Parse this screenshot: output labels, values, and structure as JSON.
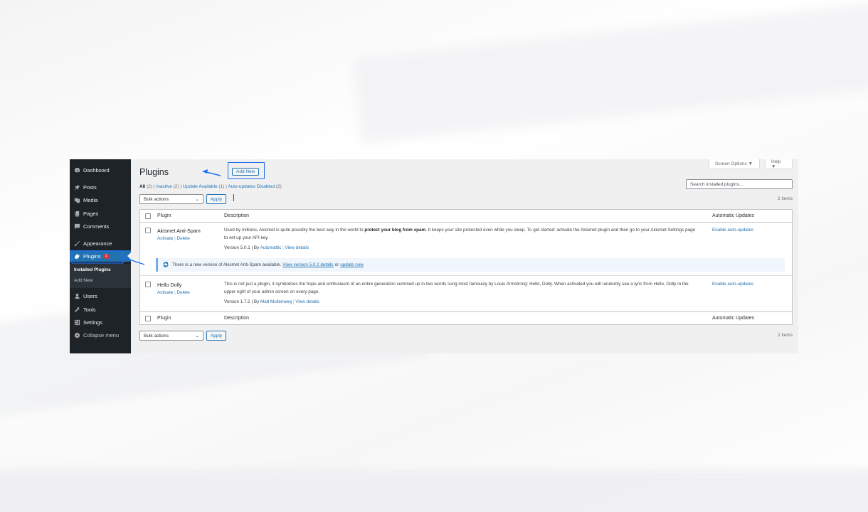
{
  "sidebar": {
    "items": [
      {
        "label": "Dashboard",
        "icon": "dashboard-icon"
      },
      {
        "label": "Posts",
        "icon": "pin-icon"
      },
      {
        "label": "Media",
        "icon": "media-icon"
      },
      {
        "label": "Pages",
        "icon": "pages-icon"
      },
      {
        "label": "Comments",
        "icon": "comment-icon"
      },
      {
        "label": "Appearance",
        "icon": "brush-icon"
      },
      {
        "label": "Plugins",
        "icon": "plug-icon",
        "badge": "1",
        "active": true
      },
      {
        "label": "Users",
        "icon": "user-icon"
      },
      {
        "label": "Tools",
        "icon": "wrench-icon"
      },
      {
        "label": "Settings",
        "icon": "settings-icon"
      },
      {
        "label": "Collapse menu",
        "icon": "collapse-icon"
      }
    ],
    "submenu": [
      {
        "label": "Installed Plugins",
        "current": true
      },
      {
        "label": "Add New",
        "current": false
      }
    ]
  },
  "header": {
    "title": "Plugins",
    "add_new_label": "Add New",
    "screen_options_label": "Screen Options ▼",
    "help_label": "Help ▼"
  },
  "views": {
    "all": "All",
    "all_count": "(2)",
    "inactive": "Inactive",
    "inactive_count": "(2)",
    "update": "Update Available",
    "update_count": "(1)",
    "autoupdates": "Auto-updates Disabled",
    "autoupdates_count": "(2)"
  },
  "search": {
    "placeholder": "Search installed plugins..."
  },
  "bulk": {
    "label": "Bulk actions",
    "apply": "Apply",
    "items": "2 items"
  },
  "table": {
    "columns": {
      "plugin": "Plugin",
      "description": "Description",
      "auto": "Automatic Updates"
    },
    "rows": [
      {
        "name": "Akismet Anti-Spam",
        "activate": "Activate",
        "delete": "Delete",
        "desc_pre": "Used by millions, Akismet is quite possibly the best way in the world to ",
        "desc_bold": "protect your blog from spam",
        "desc_post": ". It keeps your site protected even while you sleep. To get started: activate the Akismet plugin and then go to your Akismet Settings page to set up your API key.",
        "version": "Version 5.0.1 | By ",
        "author": "Automattic",
        "view_details": "View details",
        "auto_link": "Enable auto-updates"
      },
      {
        "name": "Hello Dolly",
        "activate": "Activate",
        "delete": "Delete",
        "desc": "This is not just a plugin, it symbolizes the hope and enthusiasm of an entire generation summed up in two words sung most famously by Louis Armstrong: Hello, Dolly. When activated you will randomly see a lyric from Hello, Dolly in the upper right of your admin screen on every page.",
        "version": "Version 1.7.2 | By ",
        "author": "Matt Mullenweg",
        "view_details": "View details",
        "auto_link": "Enable auto-updates"
      }
    ],
    "notice": {
      "text": "There is a new version of Akismet Anti-Spam available.",
      "link1": "View version 5.0.2 details",
      "or": "or",
      "link2": "update now"
    }
  },
  "colors": {
    "accent": "#2271b1",
    "sidebar_bg": "#1d2327",
    "highlight": "#1e6ff5"
  }
}
